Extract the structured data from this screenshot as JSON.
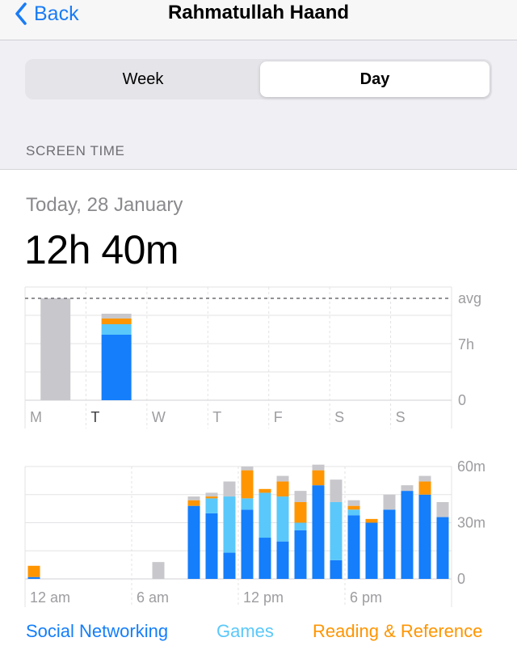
{
  "nav": {
    "back_label": "Back",
    "title": "Rahmatullah Haand"
  },
  "segments": [
    {
      "label": "Week",
      "selected": false
    },
    {
      "label": "Day",
      "selected": true
    }
  ],
  "section_header": "SCREEN TIME",
  "date_label": "Today, 28 January",
  "total_time": "12h 40m",
  "colors": {
    "social": "#147efb",
    "games": "#5ac8fa",
    "reading": "#ff9500",
    "other": "#c8c8cc",
    "grid": "#e3e3e6",
    "tick_text": "#9d9da1",
    "accent": "#1a7cf5"
  },
  "legend": [
    {
      "label": "Social Networking",
      "color": "#147efb"
    },
    {
      "label": "Games",
      "color": "#5ac8fa"
    },
    {
      "label": "Reading & Reference",
      "color": "#ff9500"
    }
  ],
  "chart_data": [
    {
      "type": "bar",
      "stacked": true,
      "unit": "hours",
      "categories": [
        "M",
        "T",
        "W",
        "T",
        "F",
        "S",
        "S"
      ],
      "highlight_category_index": 1,
      "y_ticks": [
        "avg",
        "7h",
        "0"
      ],
      "ylim": [
        0,
        14
      ],
      "avg_value": 12.6,
      "series": [
        {
          "name": "Social Networking",
          "values": [
            0,
            8.1,
            0,
            0,
            0,
            0,
            0
          ]
        },
        {
          "name": "Games",
          "values": [
            0,
            1.3,
            0,
            0,
            0,
            0,
            0
          ]
        },
        {
          "name": "Reading & Reference",
          "values": [
            0,
            0.7,
            0,
            0,
            0,
            0,
            0
          ]
        },
        {
          "values": [
            12.6,
            0.6,
            0,
            0,
            0,
            0,
            0
          ]
        }
      ]
    },
    {
      "type": "bar",
      "stacked": true,
      "unit": "minutes",
      "x_tick_labels": [
        "12 am",
        "6 am",
        "12 pm",
        "6 pm"
      ],
      "y_ticks": [
        "60m",
        "30m",
        "0"
      ],
      "ylim": [
        0,
        60
      ],
      "hours": [
        0,
        1,
        2,
        3,
        4,
        5,
        6,
        7,
        8,
        9,
        10,
        11,
        12,
        13,
        14,
        15,
        16,
        17,
        18,
        19,
        20,
        21,
        22,
        23
      ],
      "series": [
        {
          "name": "Social Networking",
          "values": [
            1,
            0,
            0,
            0,
            0,
            0,
            0,
            0,
            0,
            39,
            35,
            14,
            37,
            22,
            20,
            26,
            50,
            10,
            34,
            30,
            37,
            47,
            45,
            33
          ]
        },
        {
          "name": "Games",
          "values": [
            0,
            0,
            0,
            0,
            0,
            0,
            0,
            0,
            0,
            0,
            8,
            30,
            6,
            24,
            24,
            4,
            0,
            31,
            3,
            0,
            0,
            0,
            0,
            0
          ]
        },
        {
          "name": "Reading & Reference",
          "values": [
            6,
            0,
            0,
            0,
            0,
            0,
            0,
            0,
            0,
            3,
            1,
            0,
            15,
            2,
            8,
            11,
            8,
            0,
            2,
            2,
            0,
            0,
            7,
            0
          ]
        },
        {
          "values": [
            0,
            0,
            0,
            0,
            0,
            0,
            0,
            9,
            0,
            2,
            2,
            8,
            2,
            0,
            3,
            6,
            3,
            12,
            3,
            0,
            8,
            3,
            3,
            8
          ]
        }
      ]
    }
  ]
}
